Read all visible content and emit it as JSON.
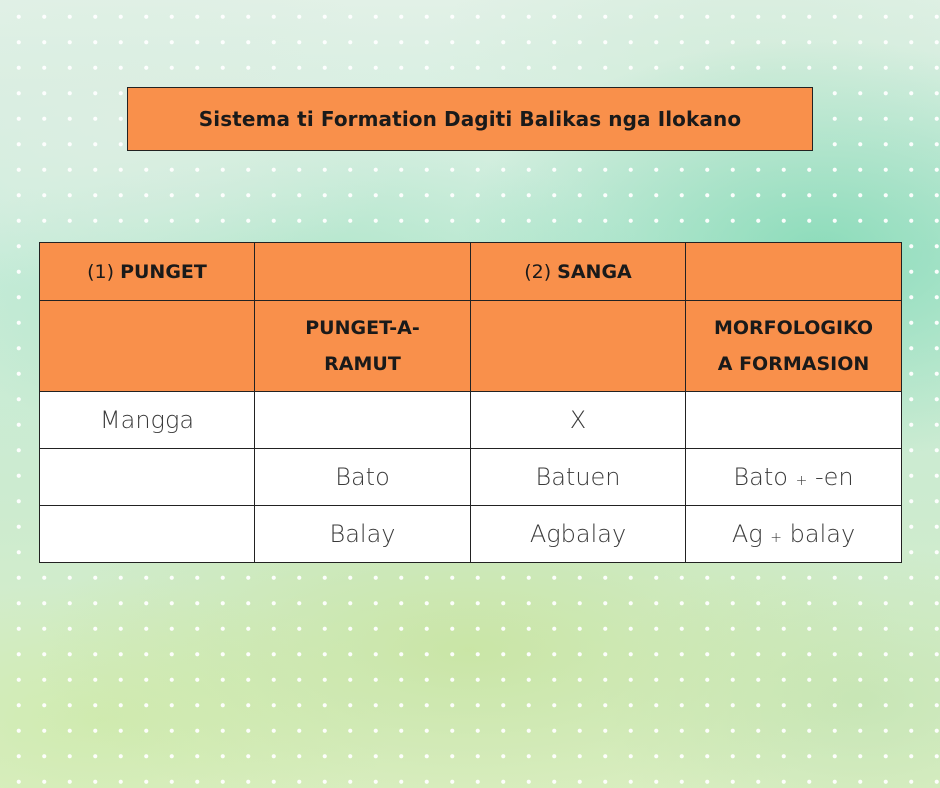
{
  "title": "Sistema ti Formation Dagiti Balikas nga Ilokano",
  "header_row_1": [
    {
      "prefix": "(1) ",
      "label": "PUNGET"
    },
    {
      "prefix": "",
      "label": ""
    },
    {
      "prefix": "(2) ",
      "label": "SANGA"
    },
    {
      "prefix": "",
      "label": ""
    }
  ],
  "header_row_2": [
    {
      "line1": "",
      "line2": ""
    },
    {
      "line1": "PUNGET-A-",
      "line2": "RAMUT"
    },
    {
      "line1": "",
      "line2": ""
    },
    {
      "line1": "MORFOLOGIKO",
      "line2": "A FORMASION"
    }
  ],
  "rows": [
    {
      "c1": "Mangga",
      "c2": "",
      "c3": "X",
      "c4a": "",
      "c4op": "",
      "c4b": ""
    },
    {
      "c1": "",
      "c2": "Bato",
      "c3": "Batuen",
      "c4a": "Bato ",
      "c4op": "+",
      "c4b": " -en"
    },
    {
      "c1": "",
      "c2": "Balay",
      "c3": "Agbalay",
      "c4a": "Ag ",
      "c4op": "+",
      "c4b": " balay"
    }
  ],
  "colors": {
    "header_bg": "#f9904b",
    "cell_bg": "#ffffff",
    "border": "#222222"
  }
}
